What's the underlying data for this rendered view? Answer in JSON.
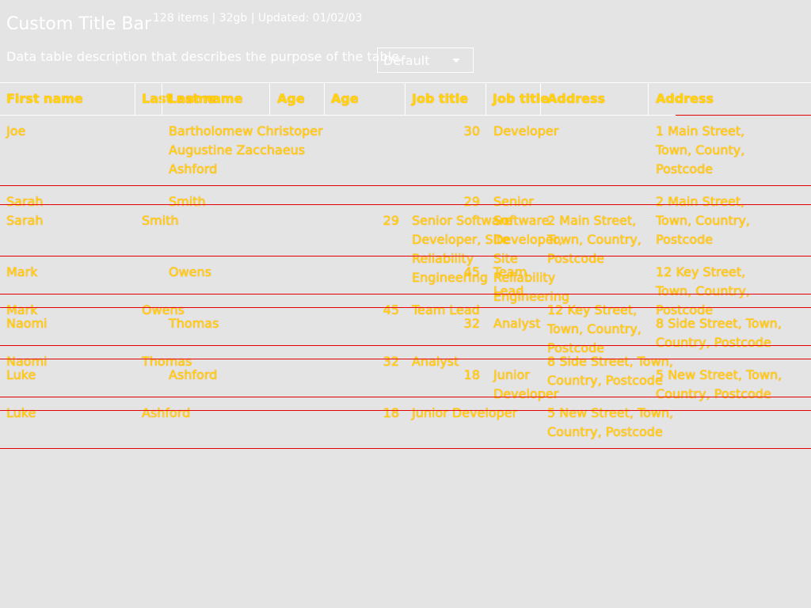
{
  "header": {
    "title": "Custom Title Bar",
    "meta": "128 items | 32gb | Updated: 01/02/03",
    "description": "Data table description that describes the purpose of the table.",
    "select_value": "Default"
  },
  "columns": [
    "First name",
    "Last name",
    "Age",
    "Job title",
    "Address"
  ],
  "rows": [
    {
      "first": "Joe",
      "last": "Bartholomew Christoper Augustine Zacchaeus Ashford",
      "age": "30",
      "job": "Developer",
      "address": "1 Main Street, Town, County, Postcode"
    },
    {
      "first": "Sarah",
      "last": "Smith",
      "age": "29",
      "job": "Senior Software Developer, Site Reliability Engineering",
      "address": "2 Main Street, Town, Country, Postcode"
    },
    {
      "first": "Mark",
      "last": "Owens",
      "age": "45",
      "job": "Team Lead",
      "address": "12 Key Street, Town, Country, Postcode"
    },
    {
      "first": "Naomi",
      "last": "Thomas",
      "age": "32",
      "job": "Analyst",
      "address": "8 Side Street, Town, Country, Postcode"
    },
    {
      "first": "Luke",
      "last": "Ashford",
      "age": "18",
      "job": "Junior Developer",
      "address": "5 New Street, Town, Country, Postcode"
    }
  ],
  "colors": {
    "background": "#e4e4e4",
    "text": "#ffffff",
    "overlay_text": "#ffd700",
    "overlay_line": "#e60000"
  }
}
